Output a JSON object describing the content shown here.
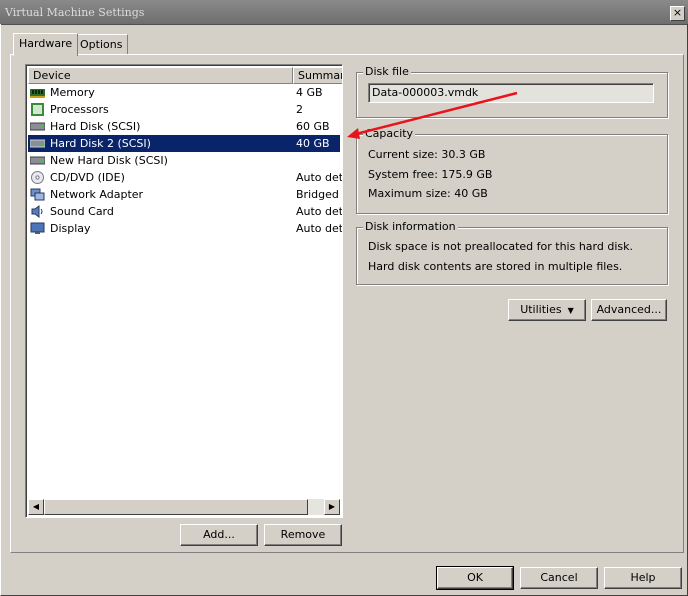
{
  "window": {
    "title": "Virtual Machine Settings",
    "close_glyph": "×"
  },
  "tabs": [
    {
      "label": "Hardware",
      "active": true
    },
    {
      "label": "Options",
      "active": false
    }
  ],
  "device_list": {
    "columns": {
      "device": "Device",
      "summary": "Summary"
    },
    "rows": [
      {
        "name": "Memory",
        "summary": "4 GB",
        "icon": "memory-icon"
      },
      {
        "name": "Processors",
        "summary": "2",
        "icon": "processor-icon"
      },
      {
        "name": "Hard Disk (SCSI)",
        "summary": "60 GB",
        "icon": "hard-disk-icon"
      },
      {
        "name": "Hard Disk 2 (SCSI)",
        "summary": "40 GB",
        "icon": "hard-disk-icon",
        "selected": true
      },
      {
        "name": "New Hard Disk (SCSI)",
        "summary": "",
        "icon": "hard-disk-icon"
      },
      {
        "name": "CD/DVD (IDE)",
        "summary": "Auto det",
        "icon": "cd-dvd-icon"
      },
      {
        "name": "Network Adapter",
        "summary": "Bridged",
        "icon": "network-adapter-icon"
      },
      {
        "name": "Sound Card",
        "summary": "Auto det",
        "icon": "sound-card-icon"
      },
      {
        "name": "Display",
        "summary": "Auto det",
        "icon": "display-icon"
      }
    ],
    "add_label": "Add...",
    "remove_label": "Remove"
  },
  "disk_file": {
    "legend": "Disk file",
    "value": "Data-000003.vmdk"
  },
  "capacity": {
    "legend": "Capacity",
    "current_size": "Current size: 30.3 GB",
    "system_free": "System free: 175.9 GB",
    "maximum_size": "Maximum size: 40 GB"
  },
  "disk_information": {
    "legend": "Disk information",
    "line1": "Disk space is not preallocated for this hard disk.",
    "line2": "Hard disk contents are stored in multiple files."
  },
  "actions": {
    "utilities_label": "Utilities",
    "advanced_label": "Advanced..."
  },
  "footer": {
    "ok_label": "OK",
    "cancel_label": "Cancel",
    "help_label": "Help"
  },
  "annotation": {
    "arrow_color": "#e8141c"
  },
  "colors": {
    "selection": "#0a246a",
    "dialog_face": "#d4d0c8"
  }
}
